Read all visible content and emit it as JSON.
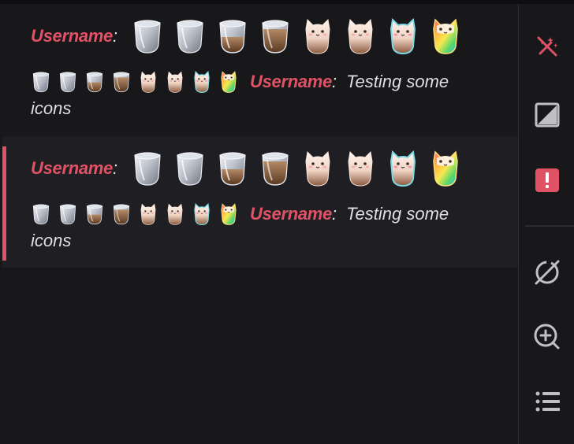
{
  "messages": [
    {
      "username": "Username",
      "separator": ":",
      "text": "Testing some",
      "text_wrap": "icons",
      "highlighted": false
    },
    {
      "username": "Username",
      "separator": ":",
      "text": "Testing some",
      "text_wrap": "icons",
      "highlighted": true
    }
  ],
  "badge_icons": [
    "empty-glass-cup-icon",
    "empty-glass-cup-icon",
    "half-filled-coffee-cup-icon",
    "coffee-cup-icon",
    "cat-cup-icon",
    "cat-cup-icon",
    "teal-cat-cup-icon",
    "rainbow-cat-cup-icon"
  ],
  "sidebar": {
    "icons": [
      "magic-wand-disabled-icon",
      "contrast-square-icon",
      "alert-square-icon",
      "slash-circle-icon",
      "zoom-plus-icon",
      "list-icon"
    ]
  },
  "colors": {
    "background": "#18181b",
    "highlight_background": "#1f1f23",
    "accent": "#e05266",
    "text": "#dedee3",
    "sidebar_icon": "#bfbfc4"
  }
}
